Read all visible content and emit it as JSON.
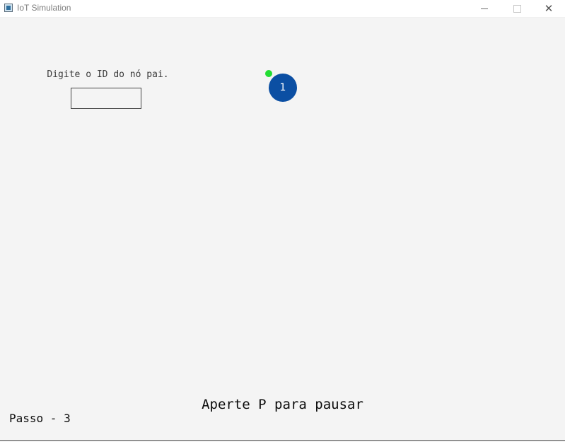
{
  "window": {
    "title": "IoT Simulation",
    "minimize_icon": "minimize-icon",
    "maximize_icon": "maximize-icon",
    "close_icon": "close-icon",
    "close_glyph": "✕"
  },
  "form": {
    "prompt": "Digite o ID do nó pai.",
    "input_value": ""
  },
  "nodes": [
    {
      "id": "1",
      "color": "#0b4fa3",
      "status_color": "#22dd33"
    }
  ],
  "footer": {
    "pause_hint": "Aperte P para pausar",
    "step": "Passo - 3"
  }
}
